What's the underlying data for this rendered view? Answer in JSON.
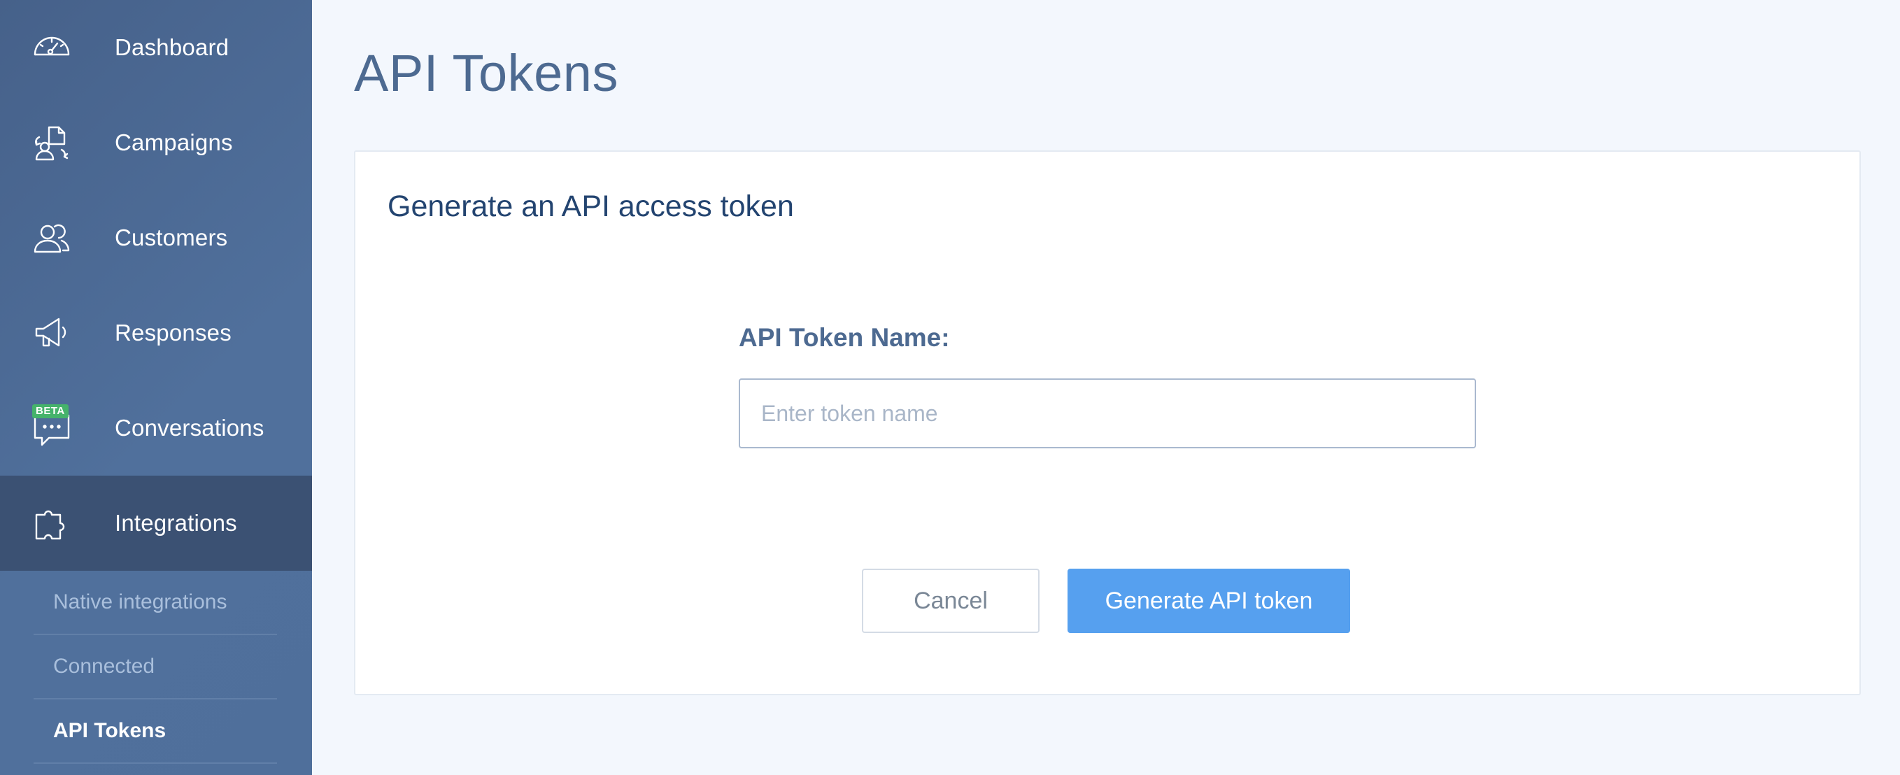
{
  "sidebar": {
    "items": [
      {
        "label": "Dashboard",
        "icon": "speedometer-icon"
      },
      {
        "label": "Campaigns",
        "icon": "campaign-icon"
      },
      {
        "label": "Customers",
        "icon": "customers-icon"
      },
      {
        "label": "Responses",
        "icon": "megaphone-icon"
      },
      {
        "label": "Conversations",
        "icon": "chat-bubble-icon",
        "badge": "BETA"
      },
      {
        "label": "Integrations",
        "icon": "puzzle-icon",
        "active": true
      }
    ],
    "subnav": [
      {
        "label": "Native integrations"
      },
      {
        "label": "Connected"
      },
      {
        "label": "API Tokens",
        "active": true
      }
    ]
  },
  "main": {
    "title": "API Tokens",
    "card": {
      "title": "Generate an API access token",
      "field_label": "API Token Name:",
      "input_placeholder": "Enter token name",
      "input_value": "",
      "cancel_label": "Cancel",
      "submit_label": "Generate API token"
    }
  },
  "colors": {
    "sidebar_bg": "#4f6f9b",
    "sidebar_active": "#3b5173",
    "accent": "#56a0ef",
    "beta_badge": "#45b36b",
    "page_bg": "#f3f7fd"
  }
}
